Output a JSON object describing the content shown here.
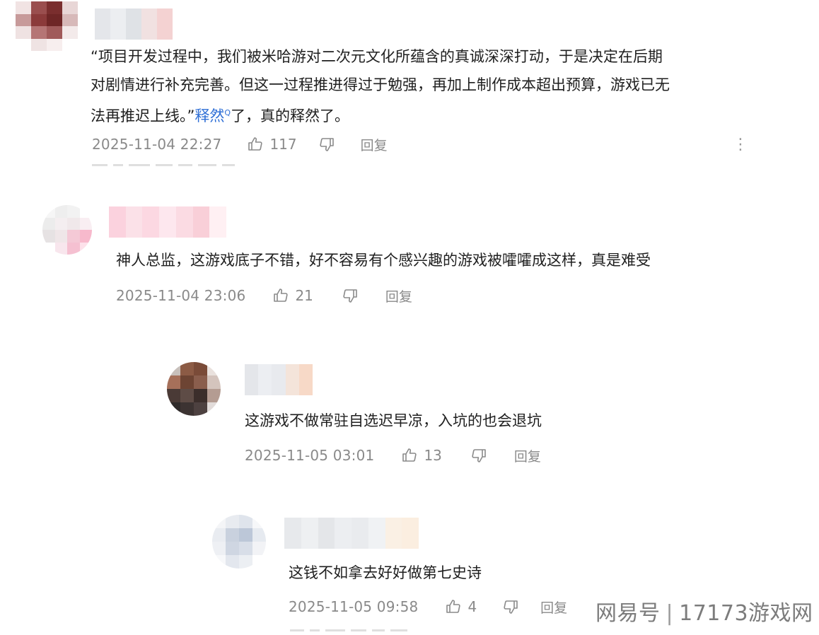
{
  "comments": [
    {
      "text_lines": [
        "“项目开发过程中，我们被米哈游对二次元文化所蕴含的真诚深深打动，于是决定在后期",
        "对剧情进行补充完善。但这一过程推进得过于勉强，再加上制作成本超出预算，游戏已无",
        "法再推迟上线。”"
      ],
      "highlight": "释然",
      "text_after_highlight": "了，真的释然了。",
      "time": "2025-11-04 22:27",
      "likes": "117",
      "reply_label": "回复",
      "more": "⋮"
    },
    {
      "text": "神人总监，这游戏底子不错，好不容易有个感兴趣的游戏被嚯嚯成这样，真是难受",
      "time": "2025-11-04 23:06",
      "likes": "21",
      "reply_label": "回复"
    },
    {
      "text": "这游戏不做常驻自选迟早凉，入坑的也会退坑",
      "time": "2025-11-05 03:01",
      "likes": "13",
      "reply_label": "回复"
    },
    {
      "text": "这钱不如拿去好好做第七史诗",
      "time": "2025-11-05 09:58",
      "likes": "4",
      "reply_label": "回复"
    }
  ],
  "watermark": {
    "left": "网易号",
    "separator": "|",
    "right": "17173游戏网"
  },
  "colors": {
    "text": "#1f1f1f",
    "meta": "#8a8a8a",
    "highlight": "#2f6fd6"
  },
  "icons": [
    "thumb-up-icon",
    "thumb-down-icon",
    "more-vertical-icon"
  ]
}
